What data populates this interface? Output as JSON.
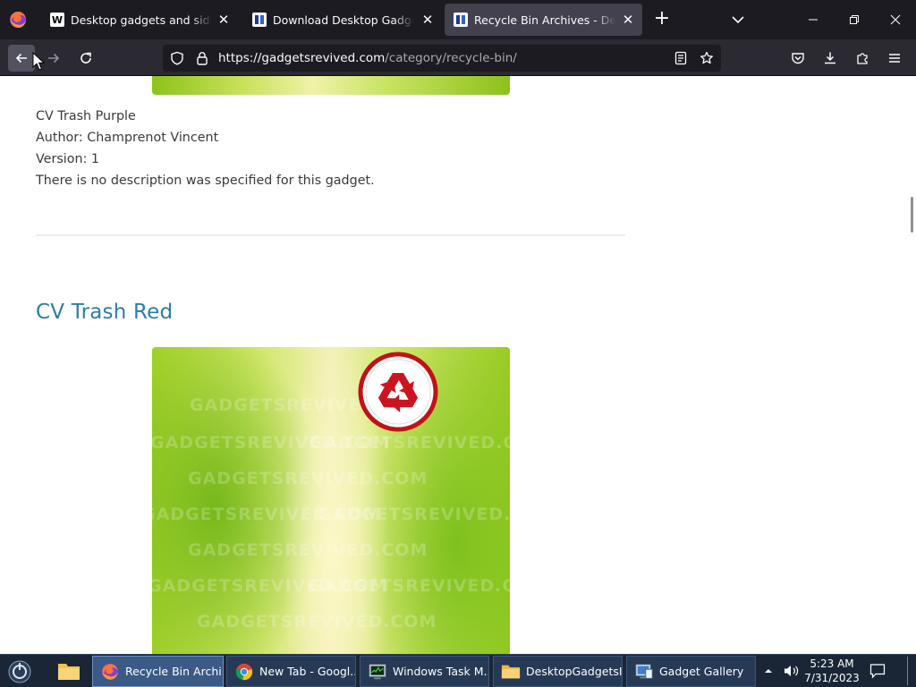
{
  "browser": {
    "tabs": [
      {
        "title": "Desktop gadgets and sidebar fo",
        "favicon": "wikipedia-w-icon",
        "active": false
      },
      {
        "title": "Download Desktop Gadgets and",
        "favicon": "gadgetsrevived-icon",
        "active": false
      },
      {
        "title": "Recycle Bin Archives - Desktop",
        "favicon": "gadgetsrevived-icon",
        "active": true
      }
    ],
    "url": {
      "host": "https://gadgetsrevived.com",
      "path": "/category/recycle-bin/"
    }
  },
  "page": {
    "prev_post": {
      "name_line": "CV Trash Purple",
      "author_line": "Author: Champrenot Vincent",
      "version_line": "Version: 1",
      "description": "There is no description was specified for this gadget."
    },
    "post": {
      "title": "CV Trash Red",
      "watermark": "GADGETSREVIVED.COM"
    }
  },
  "taskbar": {
    "items": [
      {
        "label": "Recycle Bin Archi...",
        "icon": "firefox-icon"
      },
      {
        "label": "New Tab - Googl...",
        "icon": "chrome-icon"
      },
      {
        "label": "Windows Task M...",
        "icon": "task-manager-icon"
      },
      {
        "label": "DesktopGadgetsI...",
        "icon": "folder-icon"
      },
      {
        "label": "Gadget Gallery",
        "icon": "gadget-gallery-icon"
      }
    ],
    "clock": {
      "time": "5:23 AM",
      "date": "7/31/2023"
    }
  },
  "colors": {
    "accent_link": "#2b7fa3",
    "recycle_red": "#d0121b",
    "tab_bar": "#1c1b22"
  }
}
